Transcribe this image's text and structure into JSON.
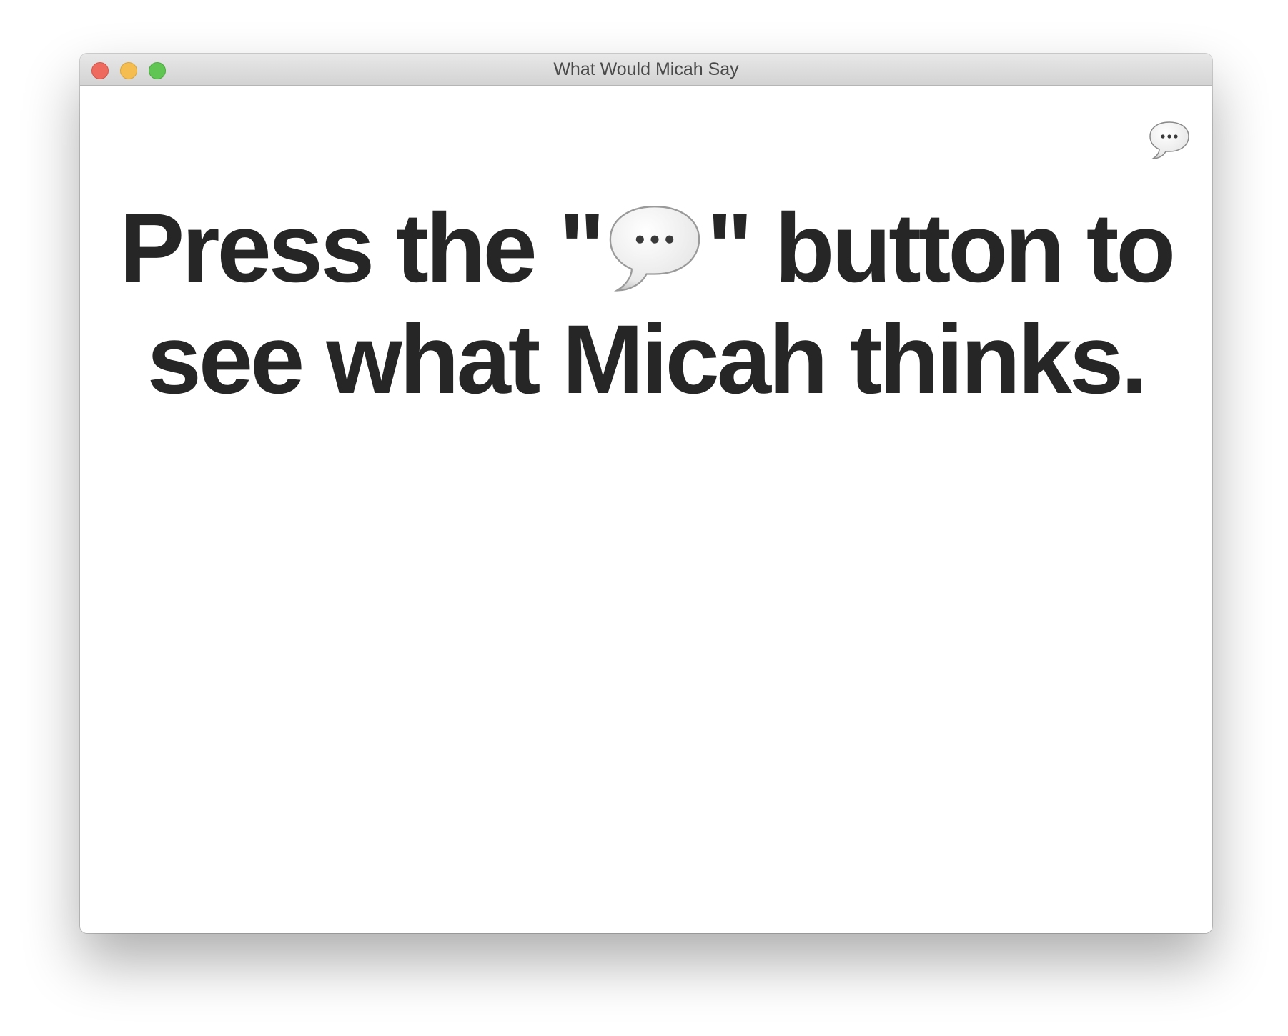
{
  "window": {
    "title": "What Would Micah Say"
  },
  "toolbar": {
    "say_button_icon": "speech-balloon-icon"
  },
  "message": {
    "before_icon": "Press the \"",
    "icon": "speech-balloon-icon",
    "after_icon": "\" button to see what Micah thinks."
  },
  "colors": {
    "close": "#ee6a5e",
    "minimize": "#f5bd4f",
    "zoom": "#61c554",
    "text": "#262626"
  }
}
